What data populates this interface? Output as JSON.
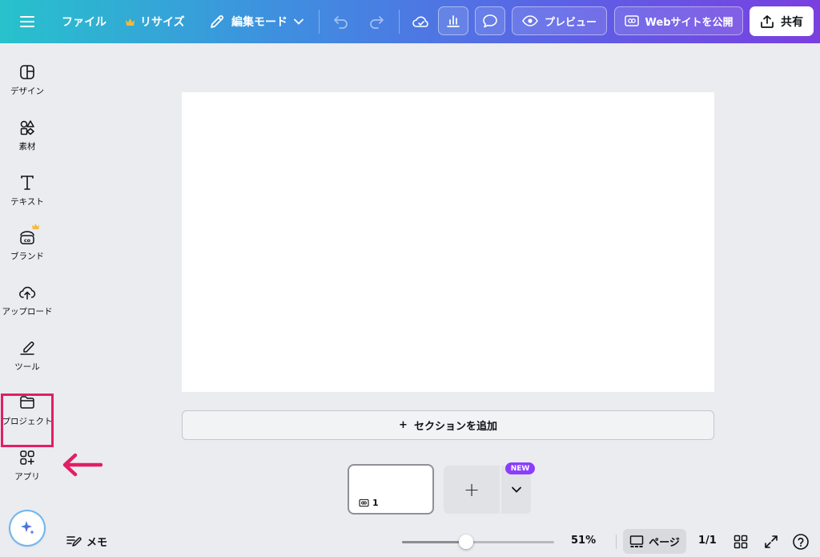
{
  "topbar": {
    "file_label": "ファイル",
    "resize_label": "リサイズ",
    "edit_mode_label": "編集モード",
    "preview_label": "プレビュー",
    "publish_label": "Webサイトを公開",
    "share_label": "共有"
  },
  "sidebar": {
    "items": [
      {
        "label": "デザイン",
        "icon": "design-icon"
      },
      {
        "label": "素材",
        "icon": "elements-icon"
      },
      {
        "label": "テキスト",
        "icon": "text-icon"
      },
      {
        "label": "ブランド",
        "icon": "brand-icon"
      },
      {
        "label": "アップロード",
        "icon": "upload-icon"
      },
      {
        "label": "ツール",
        "icon": "tools-icon"
      },
      {
        "label": "プロジェクト",
        "icon": "projects-icon"
      },
      {
        "label": "アプリ",
        "icon": "apps-icon"
      }
    ],
    "highlight_color": "#e11f63"
  },
  "canvas": {
    "add_section_label": "セクションを追加",
    "add_section_symbol": "+"
  },
  "pages": {
    "thumbnail_number": "1",
    "new_badge": "NEW",
    "add_symbol": "+"
  },
  "bottombar": {
    "memo_label": "メモ",
    "zoom_value": "51%",
    "zoom_fraction": 0.42,
    "page_label": "ページ",
    "page_count": "1/1"
  },
  "colors": {
    "gradient_start": "#27c2cc",
    "gradient_end": "#7a3fe0",
    "accent_purple": "#8b3dff",
    "annotation_red": "#e11f63"
  }
}
